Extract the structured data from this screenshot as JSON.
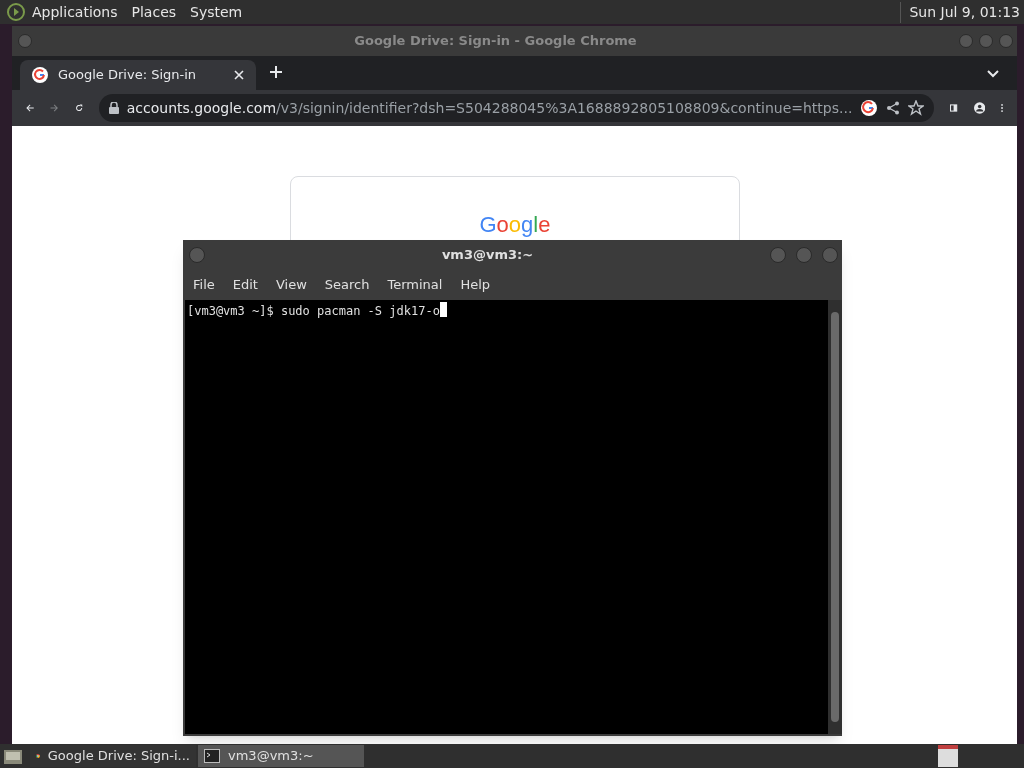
{
  "top_panel": {
    "menus": [
      "Applications",
      "Places",
      "System"
    ],
    "clock": "Sun Jul 9, 01:13"
  },
  "browser": {
    "title": "Google Drive: Sign-in - Google Chrome",
    "tabs": [
      {
        "label": "Google Drive: Sign-in",
        "selected": true
      }
    ],
    "url_host": "accounts.google.com",
    "url_path": "/v3/signin/identifier?dsh=S504288045%3A1688892805108809&continue=https...",
    "page_logo": "Google"
  },
  "terminal": {
    "title": "vm3@vm3:~",
    "menus": [
      "File",
      "Edit",
      "View",
      "Search",
      "Terminal",
      "Help"
    ],
    "lines": [
      "[vm3@vm3 ~]$ sudo pacman -S jdk17-o"
    ]
  },
  "taskbar": {
    "items": [
      {
        "label": "Google Drive: Sign-i...",
        "kind": "browser",
        "selected": false
      },
      {
        "label": "vm3@vm3:~",
        "kind": "terminal",
        "selected": true
      }
    ]
  }
}
